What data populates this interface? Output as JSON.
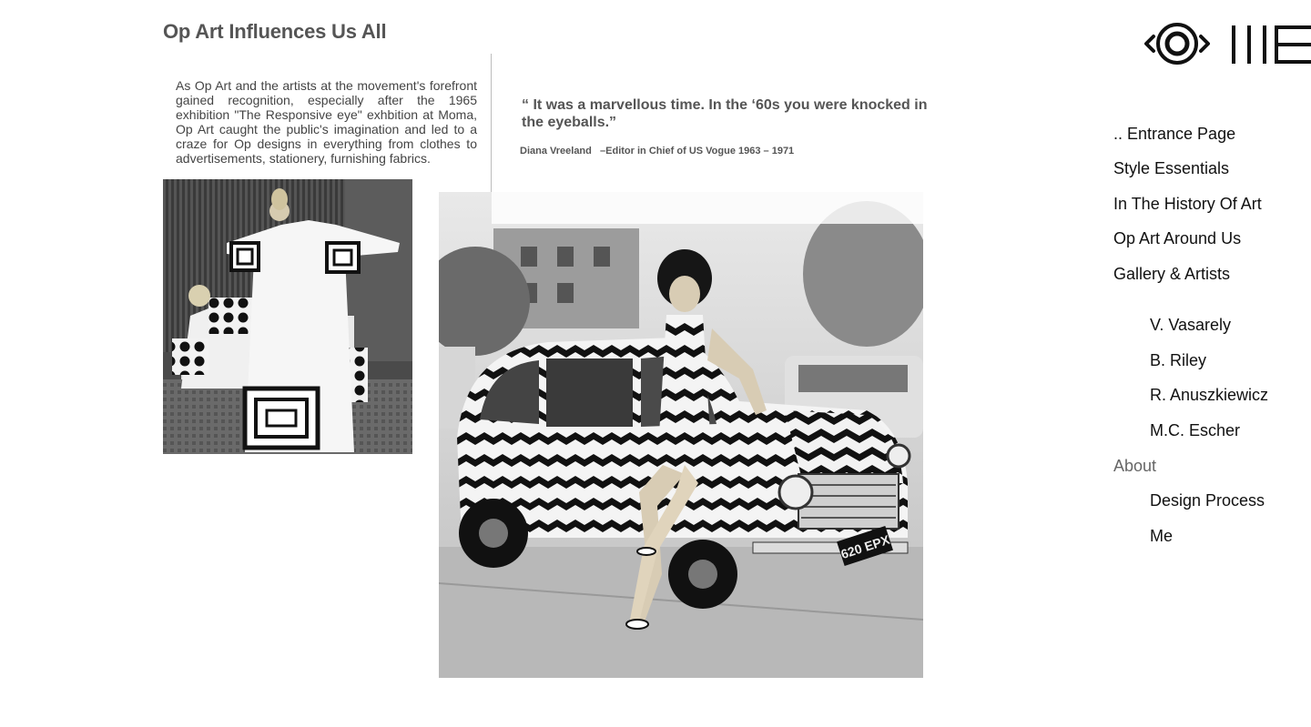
{
  "page": {
    "title": "Op Art Influences Us All",
    "intro": "As Op Art and the artists at the movement's forefront gained recognition, especially after the 1965 exhibition \"The Responsive eye\" exhbition at Moma, Op Art caught the public's imagination and led to a craze for Op designs in everything from clothes to advertisements, stationery, furnishing fabrics."
  },
  "quote": {
    "text": "“ It was a marvellous time. In the ‘60s you were knocked in the eyeballs.”",
    "source": "Diana Vreeland   –Editor in Chief of US Vogue 1963 – 1971"
  },
  "images": {
    "large_plate": "620 EPX"
  },
  "nav": {
    "entrance": ".. Entrance Page",
    "style": "Style Essentials",
    "history": "In The History Of Art",
    "around": "Op Art Around Us",
    "gallery": "Gallery & Artists",
    "vasarely": "V. Vasarely",
    "riley": "B. Riley",
    "anuszkiewicz": "R. Anuszkiewicz",
    "escher": "M.C. Escher",
    "about": "About",
    "design": "Design Process",
    "me": "Me"
  },
  "colors": {
    "title": "#555555",
    "text": "#444444",
    "nav": "#111111",
    "nav_muted": "#666666"
  },
  "icons": {
    "logo": "eye-logo-icon"
  }
}
